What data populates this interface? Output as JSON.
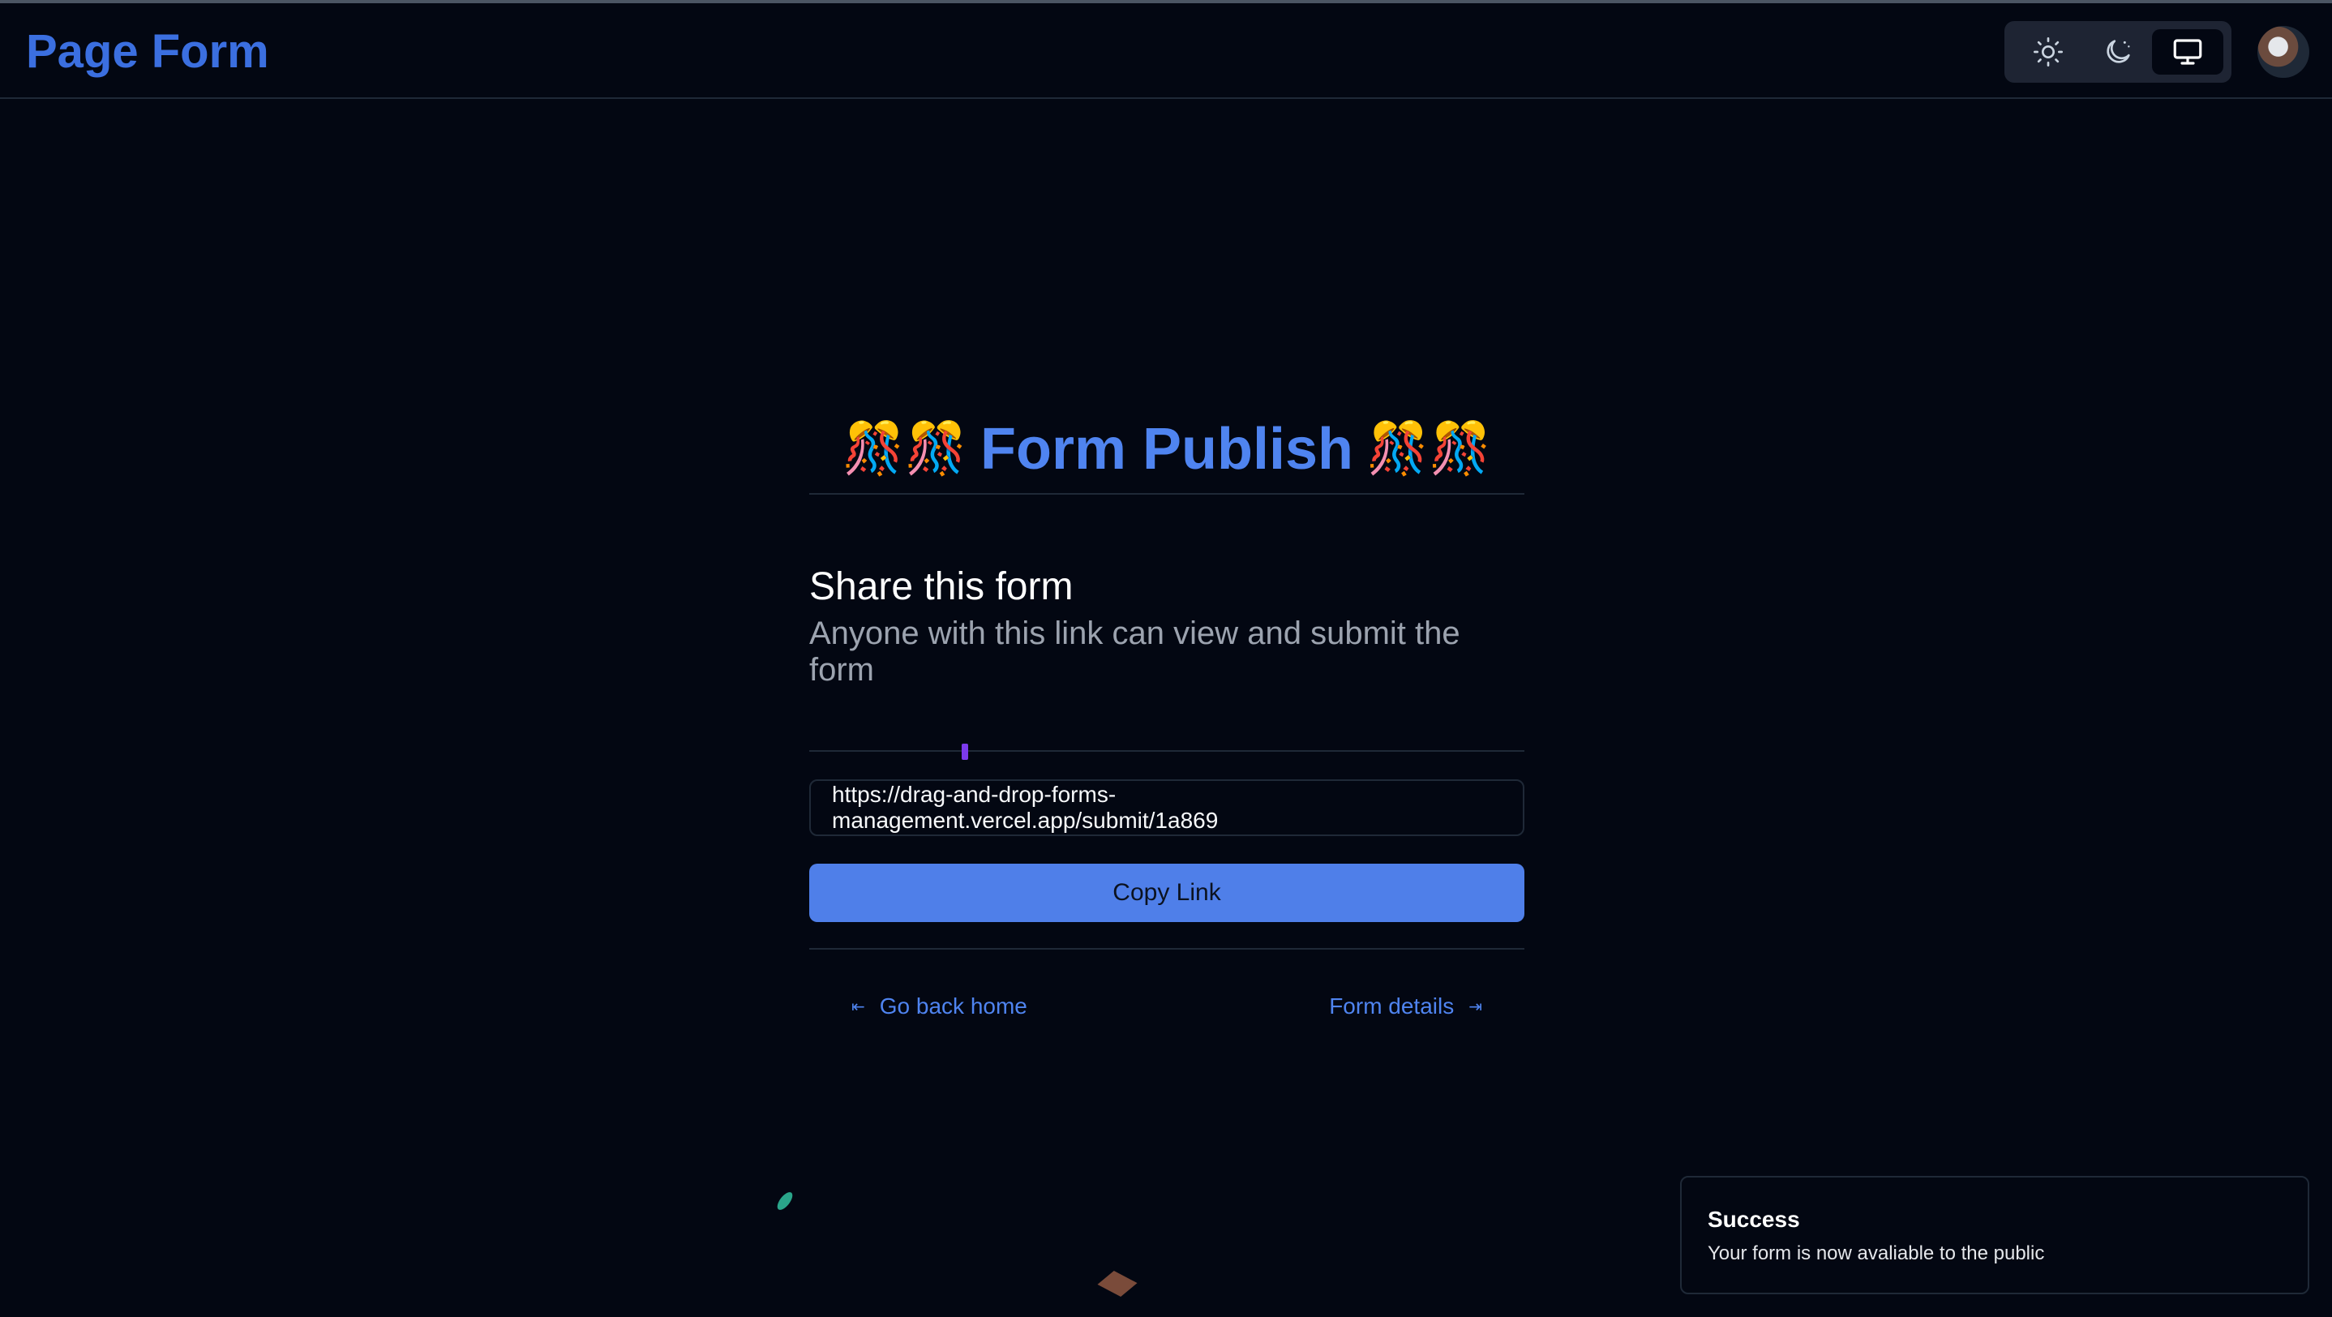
{
  "header": {
    "logo": "Page Form",
    "theme_buttons": [
      {
        "icon": "sun-icon",
        "active": false
      },
      {
        "icon": "moon-icon",
        "active": false
      },
      {
        "icon": "monitor-icon",
        "active": true
      }
    ],
    "avatar": "avatar"
  },
  "main": {
    "emoji_left": "🎊🎊",
    "title": "Form Publish",
    "emoji_right": "🎊🎊",
    "share_title": "Share this form",
    "share_subtitle": "Anyone with this link can view and submit the form",
    "link_value": "https://drag-and-drop-forms-management.vercel.app/submit/1a869",
    "copy_button": "Copy Link",
    "back_link": "Go back home",
    "details_link": "Form details"
  },
  "toast": {
    "title": "Success",
    "message": "Your form is now avaliable to the public"
  },
  "colors": {
    "background": "#030712",
    "accent": "#4f84f0",
    "button": "#4f7fe9"
  }
}
